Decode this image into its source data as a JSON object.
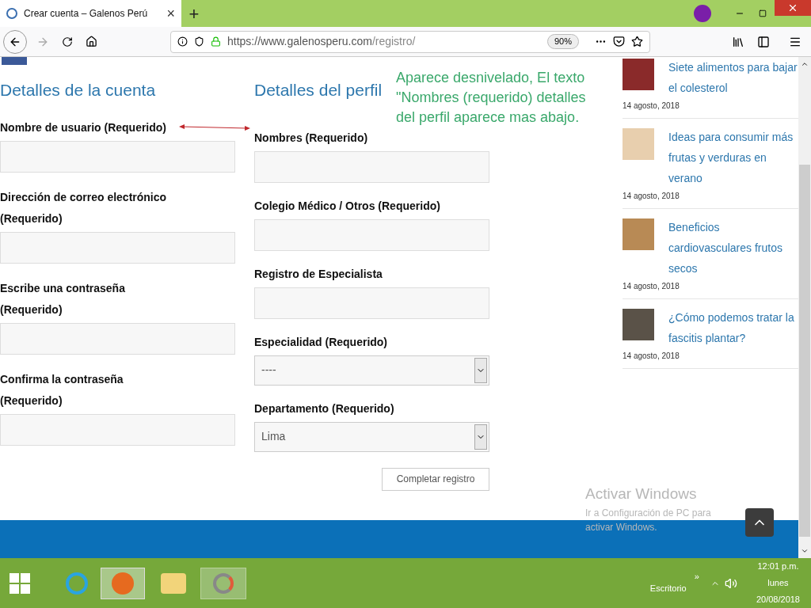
{
  "browser": {
    "tab_title": "Crear cuenta – Galenos Perú",
    "tab_close": "×",
    "new_tab": "+",
    "url_host": "https://www.galenosperu.com",
    "url_path": "/registro/",
    "zoom": "90%"
  },
  "account": {
    "heading": "Detalles de la cuenta",
    "fields": [
      {
        "label": "Nombre de usuario (Requerido)",
        "kind": "text"
      },
      {
        "label": "Dirección de correo electrónico (Requerido)",
        "kind": "text"
      },
      {
        "label": "Escribe una contraseña (Requerido)",
        "kind": "text"
      },
      {
        "label": "Confirma la contraseña (Requerido)",
        "kind": "text"
      }
    ]
  },
  "profile": {
    "heading": "Detalles del perfil",
    "fields": [
      {
        "label": "Nombres (Requerido)",
        "kind": "text"
      },
      {
        "label": "Colegio Médico / Otros (Requerido)",
        "kind": "text"
      },
      {
        "label": "Registro de Especialista",
        "kind": "text"
      },
      {
        "label": "Especialidad (Requerido)",
        "kind": "select",
        "value": "----"
      },
      {
        "label": "Departamento (Requerido)",
        "kind": "select",
        "value": "Lima"
      }
    ],
    "submit": "Completar registro"
  },
  "annotation": "Aparece desnivelado, El texto \"Nombres (requerido) detalles del perfil aparece mas abajo.",
  "sidebar": [
    {
      "title": "Siete alimentos para bajar el colesterol",
      "date": "14 agosto, 2018"
    },
    {
      "title": "Ideas para consumir más frutas y verduras en verano",
      "date": "14 agosto, 2018"
    },
    {
      "title": "Beneficios cardiovasculares frutos secos",
      "date": "14 agosto, 2018"
    },
    {
      "title": "¿Cómo podemos tratar la fascitis plantar?",
      "date": "14 agosto, 2018"
    }
  ],
  "activation": {
    "title": "Activar Windows",
    "text": "Ir a Configuración de PC para activar Windows."
  },
  "taskbar": {
    "desktop": "Escritorio",
    "more": "»",
    "time": "12:01 p.m.",
    "day": "lunes",
    "date": "20/08/2018"
  }
}
